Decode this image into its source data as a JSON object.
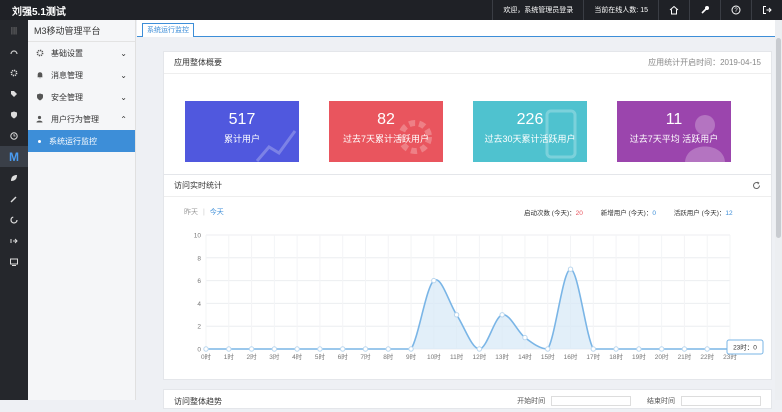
{
  "topbar": {
    "title": "刘强5.1测试",
    "welcome": "欢迎，系统管理员登录",
    "online": "当前在线人数: 15",
    "icons": [
      "home-icon",
      "wrench-icon",
      "help-icon",
      "logout-icon"
    ]
  },
  "iconbar": {
    "icons": [
      "grid-icon",
      "dashboard-icon",
      "gear-icon",
      "tag-icon",
      "shield-icon",
      "clock-icon",
      "m-logo-icon",
      "leaf-icon",
      "pen-icon",
      "refresh-icon",
      "arrow-icon",
      "monitor-icon"
    ]
  },
  "sidebar": {
    "header": "M3移动管理平台",
    "items": [
      {
        "label": "基础设置",
        "icon": "gear-icon",
        "chevron": "⌄"
      },
      {
        "label": "消息管理",
        "icon": "bell-icon",
        "chevron": "⌄"
      },
      {
        "label": "安全管理",
        "icon": "shield-icon",
        "chevron": "⌄"
      },
      {
        "label": "用户行为管理",
        "icon": "user-icon",
        "chevron": "⌃"
      }
    ],
    "subitem": "系统运行监控"
  },
  "tabs": {
    "active": "系统运行监控"
  },
  "overview": {
    "title": "应用整体概要",
    "since": "应用统计开启时间：2019-04-15",
    "cards": [
      {
        "num": "517",
        "label": "累计用户",
        "color": "#5058de"
      },
      {
        "num": "82",
        "label": "过去7天累计活跃用户",
        "color": "#e9555e"
      },
      {
        "num": "226",
        "label": "过去30天累计活跃用户",
        "color": "#4fc2cf"
      },
      {
        "num": "11",
        "label": "过去7天平均 活跃用户",
        "color": "#9b45ad"
      }
    ]
  },
  "realtime": {
    "title": "访问实时统计",
    "tab_yesterday": "昨天",
    "tab_today": "今天",
    "starts_label": "启动次数 (今天)：",
    "starts_value": "20",
    "new_label": "新增用户 (今天)：",
    "new_value": "0",
    "active_label": "活跃用户 (今天)：",
    "active_value": "12",
    "tooltip": "23时：0"
  },
  "chart_data": {
    "type": "line",
    "title": "",
    "xlabel": "",
    "ylabel": "",
    "ylim": [
      0,
      10
    ],
    "yticks": [
      0,
      2,
      4,
      6,
      8,
      10
    ],
    "categories": [
      "0时",
      "1时",
      "2时",
      "3时",
      "4时",
      "5时",
      "6时",
      "7时",
      "8时",
      "9时",
      "10时",
      "11时",
      "12时",
      "13时",
      "14时",
      "15时",
      "16时",
      "17时",
      "18时",
      "19时",
      "20时",
      "21时",
      "22时",
      "23时"
    ],
    "series": [
      {
        "name": "",
        "values": [
          0,
          0,
          0,
          0,
          0,
          0,
          0,
          0,
          0,
          0,
          6,
          3,
          0,
          3,
          1,
          0,
          7,
          0,
          0,
          0,
          0,
          0,
          0,
          0
        ]
      }
    ],
    "grid": true,
    "area": true,
    "smooth": true,
    "color": "#7ab5e6"
  },
  "bottom": {
    "title": "访问整体趋势",
    "start_label": "开始时间",
    "end_label": "结束时间"
  }
}
